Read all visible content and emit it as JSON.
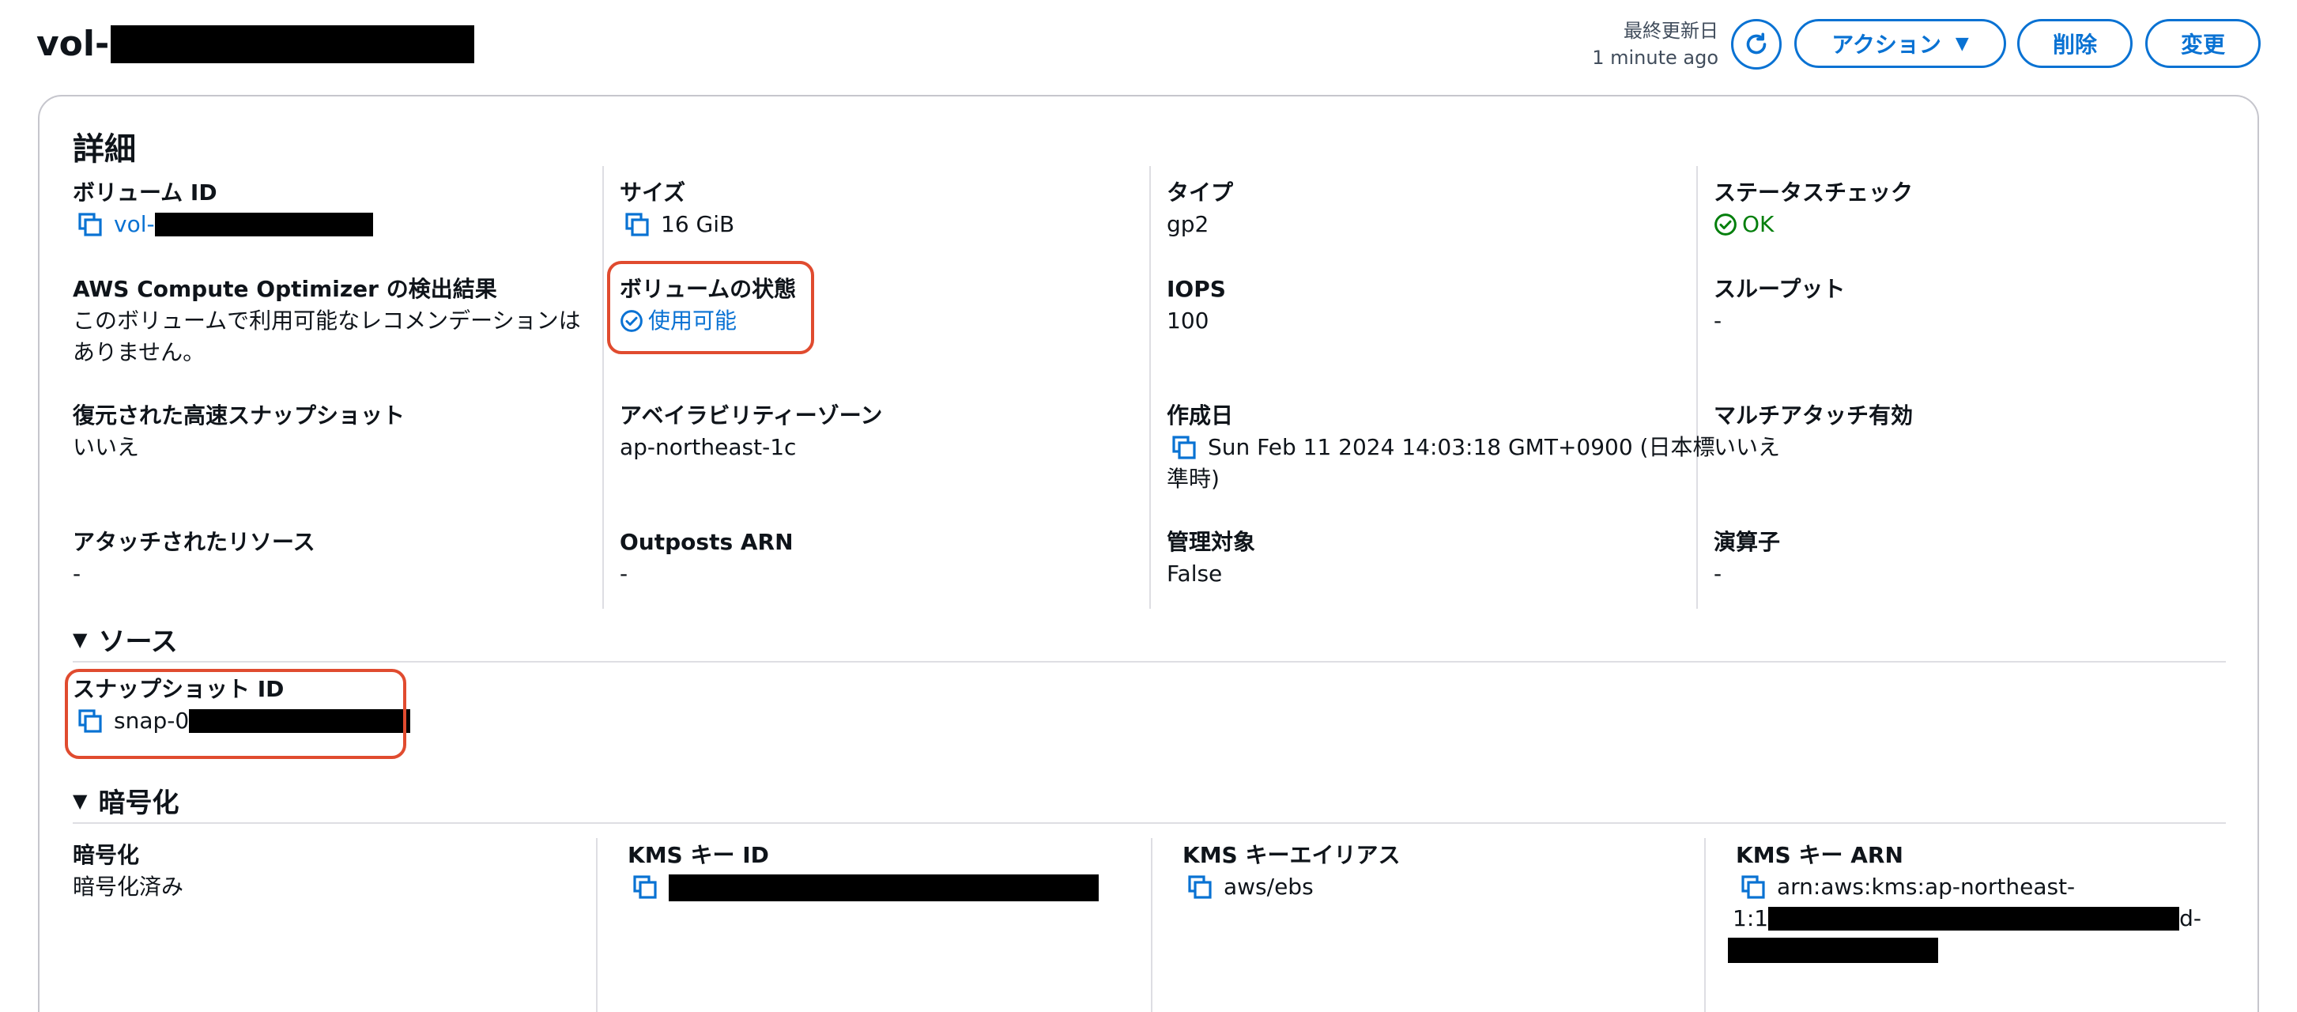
{
  "header": {
    "title_prefix": "vol-",
    "last_updated_label": "最終更新日",
    "last_updated_value": "1 minute ago",
    "action_label": "アクション",
    "delete_label": "削除",
    "edit_label": "変更"
  },
  "details": {
    "title": "詳細",
    "volume_id": {
      "label": "ボリューム ID",
      "value": "vol-"
    },
    "size": {
      "label": "サイズ",
      "value": "16 GiB"
    },
    "type": {
      "label": "タイプ",
      "value": "gp2"
    },
    "status_check": {
      "label": "ステータスチェック",
      "value": "OK"
    },
    "optimizer": {
      "label": "AWS Compute Optimizer の検出結果",
      "value_line1": "このボリュームで利用可能なレコメンデーションは",
      "value_line2": "ありません。"
    },
    "volume_state": {
      "label": "ボリュームの状態",
      "value": "使用可能"
    },
    "iops": {
      "label": "IOPS",
      "value": "100"
    },
    "throughput": {
      "label": "スループット",
      "value": "-"
    },
    "fast_snapshot": {
      "label": "復元された高速スナップショット",
      "value": "いいえ"
    },
    "az": {
      "label": "アベイラビリティーゾーン",
      "value": "ap-northeast-1c"
    },
    "created": {
      "label": "作成日",
      "value_line1": "Sun Feb 11 2024 14:03:18 GMT+0900 (日本標",
      "value_line2": "準時)"
    },
    "multi_attach": {
      "label": "マルチアタッチ有効",
      "value": "いいえ"
    },
    "attached": {
      "label": "アタッチされたリソース",
      "value": "-"
    },
    "outposts": {
      "label": "Outposts ARN",
      "value": "-"
    },
    "managed": {
      "label": "管理対象",
      "value": "False"
    },
    "operator": {
      "label": "演算子",
      "value": "-"
    }
  },
  "source": {
    "title": "ソース",
    "snapshot_id": {
      "label": "スナップショット ID",
      "value": "snap-0"
    }
  },
  "encryption": {
    "title": "暗号化",
    "encryption": {
      "label": "暗号化",
      "value": "暗号化済み"
    },
    "kms_key_id": {
      "label": "KMS キー ID"
    },
    "kms_alias": {
      "label": "KMS キーエイリアス",
      "value": "aws/ebs"
    },
    "kms_arn": {
      "label": "KMS キー ARN",
      "value_line1": "arn:aws:kms:ap-northeast-",
      "value_line2_prefix": "1:1",
      "value_line2_suffix": "d-"
    }
  },
  "colors": {
    "link": "#0972d3",
    "ok": "#037f0c",
    "highlight": "#e04b2f"
  }
}
